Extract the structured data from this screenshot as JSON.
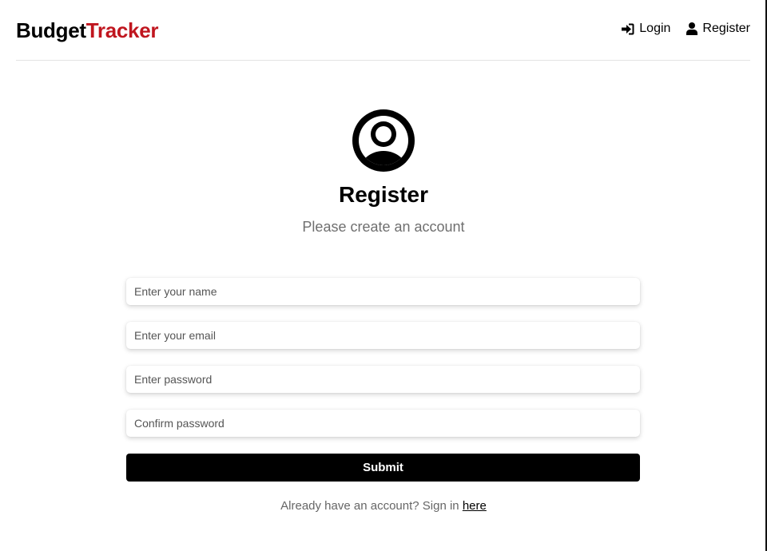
{
  "brand": {
    "part1": "Budget",
    "part2": "Tracker",
    "accent_color": "#c0161f"
  },
  "nav": {
    "login": {
      "label": "Login",
      "icon": "sign-in-icon"
    },
    "register": {
      "label": "Register",
      "icon": "user-icon"
    }
  },
  "hero": {
    "icon": "user-circle-icon",
    "title": "Register",
    "subtitle": "Please create an account"
  },
  "form": {
    "name_placeholder": "Enter your name",
    "email_placeholder": "Enter your email",
    "password_placeholder": "Enter password",
    "confirm_placeholder": "Confirm password",
    "submit_label": "Submit"
  },
  "footer": {
    "text": "Already have an account? Sign in ",
    "link_label": "here"
  }
}
